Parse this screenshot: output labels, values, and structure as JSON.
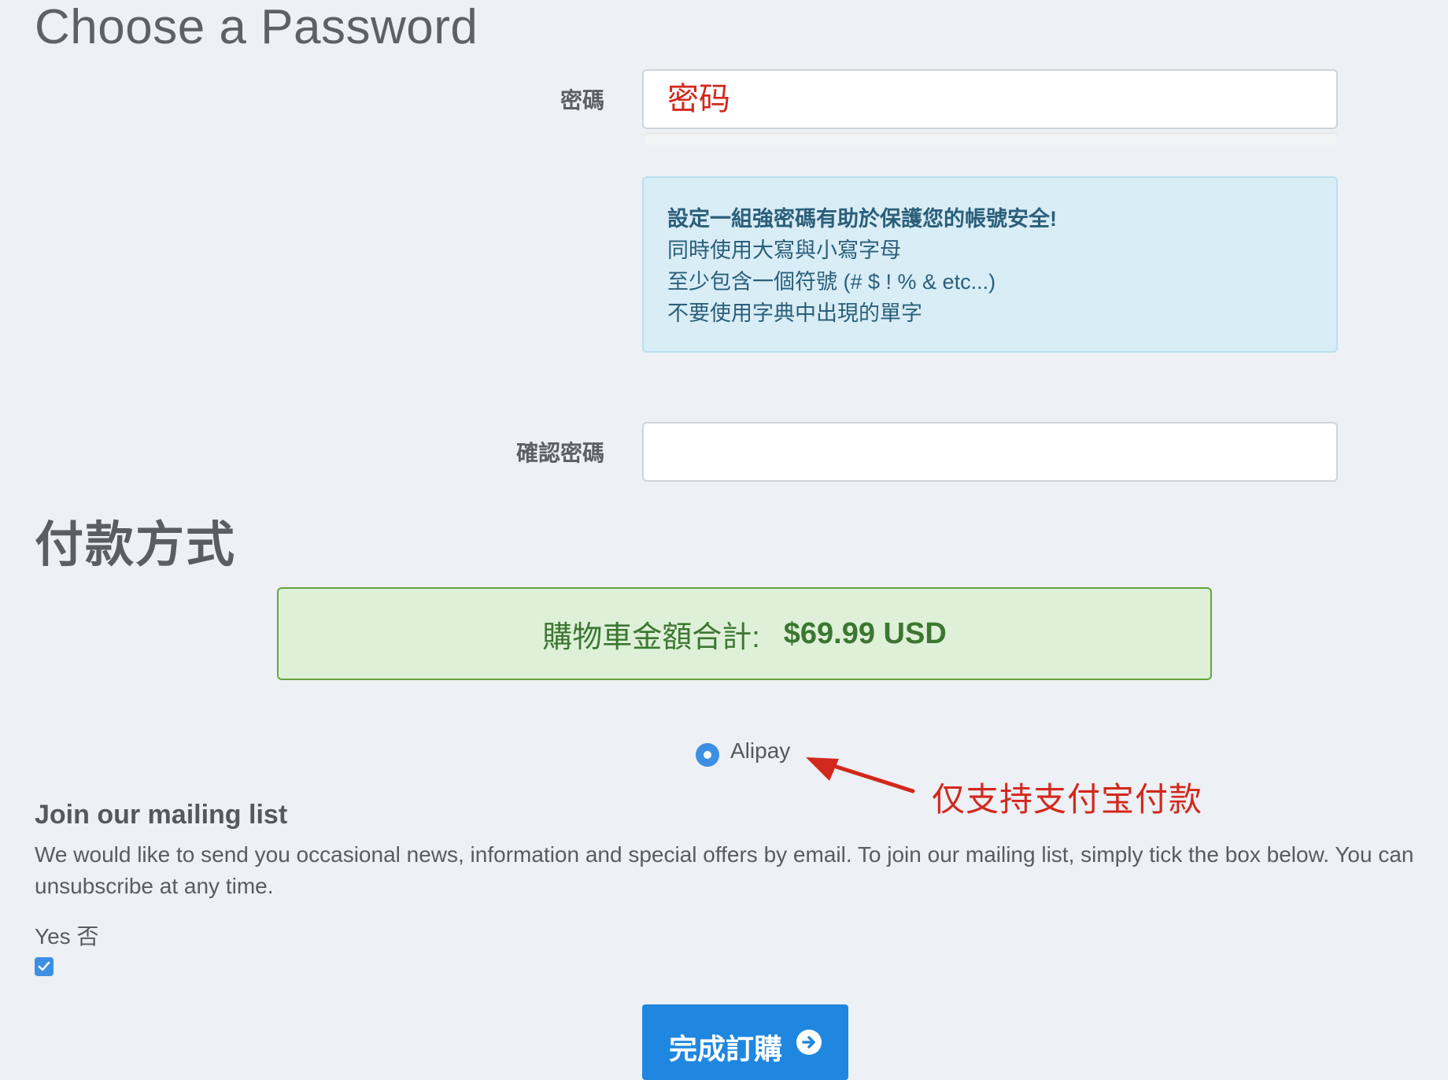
{
  "password_section": {
    "title": "Choose a Password",
    "password_label": "密碼",
    "password_placeholder": "密码",
    "confirm_label": "確認密碼",
    "tips": {
      "headline": "設定一組強密碼有助於保護您的帳號安全!",
      "lines": [
        "同時使用大寫與小寫字母",
        "至少包含一個符號 (# $ ! % & etc...)",
        "不要使用字典中出現的單字"
      ]
    }
  },
  "payment_section": {
    "title": "付款方式",
    "total_label": "購物車金額合計:",
    "total_amount": "$69.99 USD",
    "methods": [
      {
        "label": "Alipay",
        "selected": true
      }
    ]
  },
  "annotation": {
    "text": "仅支持支付宝付款",
    "color": "#d3281c"
  },
  "mailing": {
    "title": "Join our mailing list",
    "description": "We would like to send you occasional news, information and special offers by email. To join our mailing list, simply tick the box below. You can unsubscribe at any time.",
    "yes_no_label": "Yes 否",
    "checked": true
  },
  "submit": {
    "label": "完成訂購",
    "icon": "arrow-circle-right-icon"
  },
  "colors": {
    "background": "#edf0f5",
    "accent": "#1f87df",
    "info_bg": "#d9edf7",
    "success_bg": "#dff0d8",
    "success_text": "#3c7732"
  }
}
